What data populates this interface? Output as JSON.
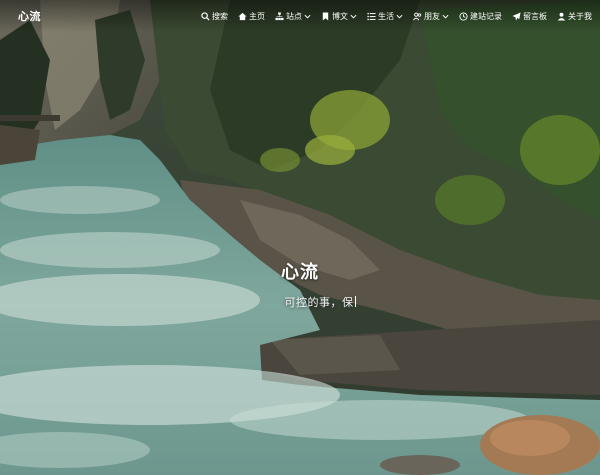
{
  "site": {
    "logo": "心流"
  },
  "nav": {
    "items": [
      {
        "label": "搜索",
        "icon": "search-icon",
        "dropdown": false
      },
      {
        "label": "主页",
        "icon": "home-icon",
        "dropdown": false
      },
      {
        "label": "站点",
        "icon": "sitemap-icon",
        "dropdown": true
      },
      {
        "label": "博文",
        "icon": "bookmark-icon",
        "dropdown": true
      },
      {
        "label": "生活",
        "icon": "list-icon",
        "dropdown": true
      },
      {
        "label": "朋友",
        "icon": "user-friends-icon",
        "dropdown": true
      },
      {
        "label": "建站记录",
        "icon": "clock-icon",
        "dropdown": false
      },
      {
        "label": "留言板",
        "icon": "paper-plane-icon",
        "dropdown": false
      },
      {
        "label": "关于我",
        "icon": "user-icon",
        "dropdown": false
      }
    ]
  },
  "hero": {
    "title": "心流",
    "subtitle": "可控的事，保"
  }
}
